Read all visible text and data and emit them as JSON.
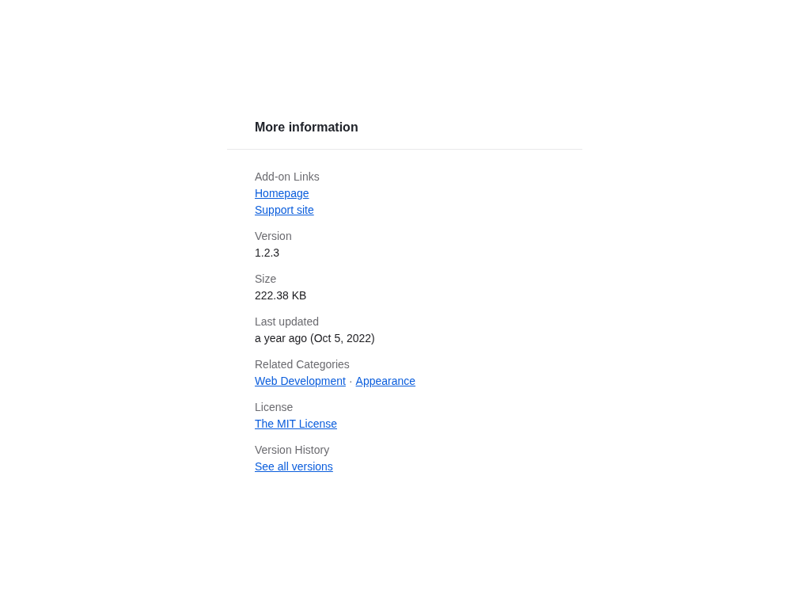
{
  "panel": {
    "title": "More information",
    "sections": [
      {
        "label": "Add-on Links",
        "lines": [
          {
            "parts": [
              {
                "kind": "link",
                "text": "Homepage"
              }
            ]
          },
          {
            "parts": [
              {
                "kind": "link",
                "text": "Support site"
              }
            ]
          }
        ]
      },
      {
        "label": "Version",
        "lines": [
          {
            "parts": [
              {
                "kind": "text",
                "text": "1.2.3"
              }
            ]
          }
        ]
      },
      {
        "label": "Size",
        "lines": [
          {
            "parts": [
              {
                "kind": "text",
                "text": "222.38 KB"
              }
            ]
          }
        ]
      },
      {
        "label": "Last updated",
        "lines": [
          {
            "parts": [
              {
                "kind": "text",
                "text": "a year ago (Oct 5, 2022)"
              }
            ]
          }
        ]
      },
      {
        "label": "Related Categories",
        "lines": [
          {
            "parts": [
              {
                "kind": "link",
                "text": "Web Development"
              },
              {
                "kind": "separator",
                "text": "·"
              },
              {
                "kind": "link",
                "text": "Appearance"
              }
            ]
          }
        ]
      },
      {
        "label": "License",
        "lines": [
          {
            "parts": [
              {
                "kind": "link",
                "text": "The MIT License"
              }
            ]
          }
        ]
      },
      {
        "label": "Version History",
        "lines": [
          {
            "parts": [
              {
                "kind": "link",
                "text": "See all versions"
              }
            ]
          }
        ]
      }
    ]
  }
}
